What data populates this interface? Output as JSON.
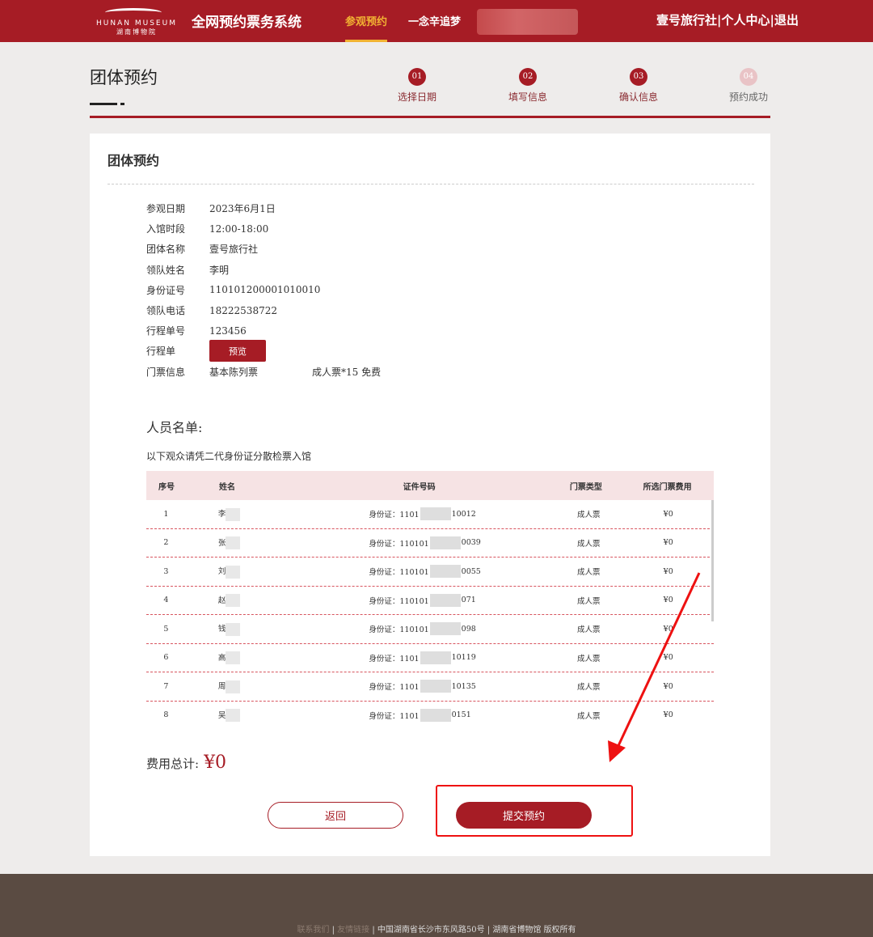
{
  "header": {
    "logo_en": "HUNAN MUSEUM",
    "logo_cn": "湖南博物院",
    "system_title": "全网预约票务系统",
    "nav": [
      "参观预约",
      "一念辛追梦"
    ],
    "user": "壹号旅行社",
    "personal": "个人中心",
    "logout": "退出"
  },
  "page": {
    "title": "团体预约",
    "steps": [
      {
        "num": "01",
        "label": "选择日期"
      },
      {
        "num": "02",
        "label": "填写信息"
      },
      {
        "num": "03",
        "label": "确认信息"
      },
      {
        "num": "04",
        "label": "预约成功"
      }
    ]
  },
  "card": {
    "title": "团体预约",
    "info": [
      {
        "k": "参观日期",
        "v": "2023年6月1日"
      },
      {
        "k": "入馆时段",
        "v": "12:00-18:00"
      },
      {
        "k": "团体名称",
        "v": "壹号旅行社"
      },
      {
        "k": "领队姓名",
        "v": "李明"
      },
      {
        "k": "身份证号",
        "v": "110101200001010010"
      },
      {
        "k": "领队电话",
        "v": "18222538722"
      },
      {
        "k": "行程单号",
        "v": "123456"
      }
    ],
    "itinerary_label": "行程单",
    "preview": "预览",
    "ticket_label": "门票信息",
    "ticket_type": "基本陈列票",
    "ticket_detail": "成人票*15 免费",
    "list_title": "人员名单:",
    "list_sub": "以下观众请凭二代身份证分散检票入馆",
    "columns": [
      "序号",
      "姓名",
      "证件号码",
      "门票类型",
      "所选门票费用"
    ],
    "rows": [
      {
        "no": "1",
        "name": "李",
        "id_prefix": "身份证：1101",
        "id_suffix": "10012",
        "type": "成人票",
        "fee": "¥0"
      },
      {
        "no": "2",
        "name": "张",
        "id_prefix": "身份证：110101",
        "id_suffix": "0039",
        "type": "成人票",
        "fee": "¥0"
      },
      {
        "no": "3",
        "name": "刘",
        "id_prefix": "身份证：110101",
        "id_suffix": "0055",
        "type": "成人票",
        "fee": "¥0"
      },
      {
        "no": "4",
        "name": "赵",
        "id_prefix": "身份证：110101",
        "id_suffix": "071",
        "type": "成人票",
        "fee": "¥0"
      },
      {
        "no": "5",
        "name": "钱",
        "id_prefix": "身份证：110101",
        "id_suffix": "098",
        "type": "成人票",
        "fee": "¥0"
      },
      {
        "no": "6",
        "name": "高",
        "id_prefix": "身份证：1101",
        "id_suffix": "10119",
        "type": "成人票",
        "fee": "¥0"
      },
      {
        "no": "7",
        "name": "周",
        "id_prefix": "身份证：1101",
        "id_suffix": "10135",
        "type": "成人票",
        "fee": "¥0"
      },
      {
        "no": "8",
        "name": "吴",
        "id_prefix": "身份证：1101",
        "id_suffix": "0151",
        "type": "成人票",
        "fee": "¥0"
      }
    ],
    "total_label": "费用总计:",
    "total": "¥0",
    "back": "返回",
    "submit": "提交预约"
  },
  "footer": {
    "contact": "联系我们",
    "links": "友情链接",
    "address": "中国湖南省长沙市东风路50号",
    "copyright": "湖南省博物馆 版权所有"
  },
  "colors": {
    "brand": "#a61c25",
    "accent": "#f2b233",
    "footer": "#5a4b42"
  }
}
